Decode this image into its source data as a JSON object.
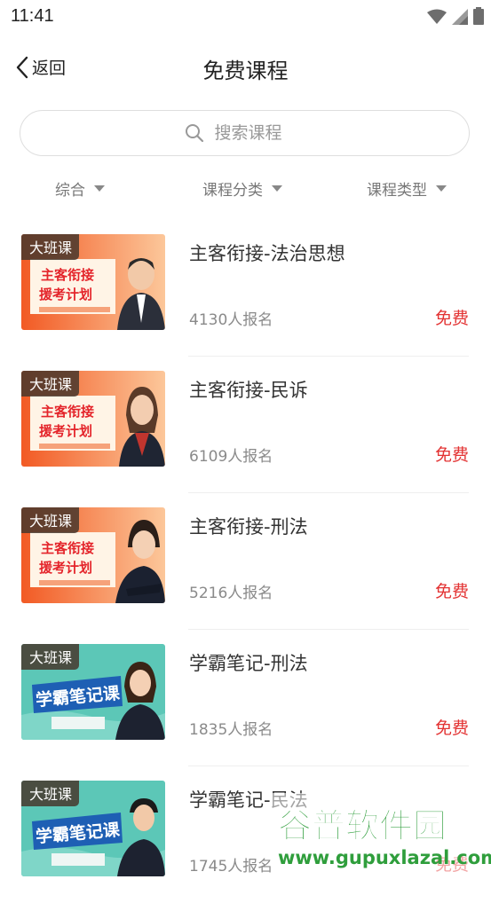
{
  "status": {
    "time": "11:41"
  },
  "nav": {
    "back_label": "返回",
    "title": "免费课程"
  },
  "search": {
    "placeholder": "搜索课程"
  },
  "filters": [
    "综合",
    "课程分类",
    "课程类型"
  ],
  "courses": [
    {
      "badge": "大班课",
      "title": "主客衔接-法治思想",
      "enrolled": "4130人报名",
      "price": "免费",
      "banner": "主客衔接 援考计划",
      "theme": "orange"
    },
    {
      "badge": "大班课",
      "title": "主客衔接-民诉",
      "enrolled": "6109人报名",
      "price": "免费",
      "banner": "主客衔接 援考计划",
      "theme": "orange"
    },
    {
      "badge": "大班课",
      "title": "主客衔接-刑法",
      "enrolled": "5216人报名",
      "price": "免费",
      "banner": "主客衔接 援考计划",
      "theme": "orange"
    },
    {
      "badge": "大班课",
      "title": "学霸笔记-刑法",
      "enrolled": "1835人报名",
      "price": "免费",
      "banner": "学霸笔记课",
      "theme": "teal"
    },
    {
      "badge": "大班课",
      "title": "学霸笔记-民法",
      "enrolled": "1745人报名",
      "price": "免费",
      "banner": "学霸笔记课",
      "theme": "teal"
    }
  ],
  "watermark": {
    "title": "谷普软件园",
    "url": "www.gupuxlazal.com"
  },
  "colors": {
    "accent": "#e33333",
    "orange": "#f26a2b",
    "teal": "#5cc7b7"
  }
}
